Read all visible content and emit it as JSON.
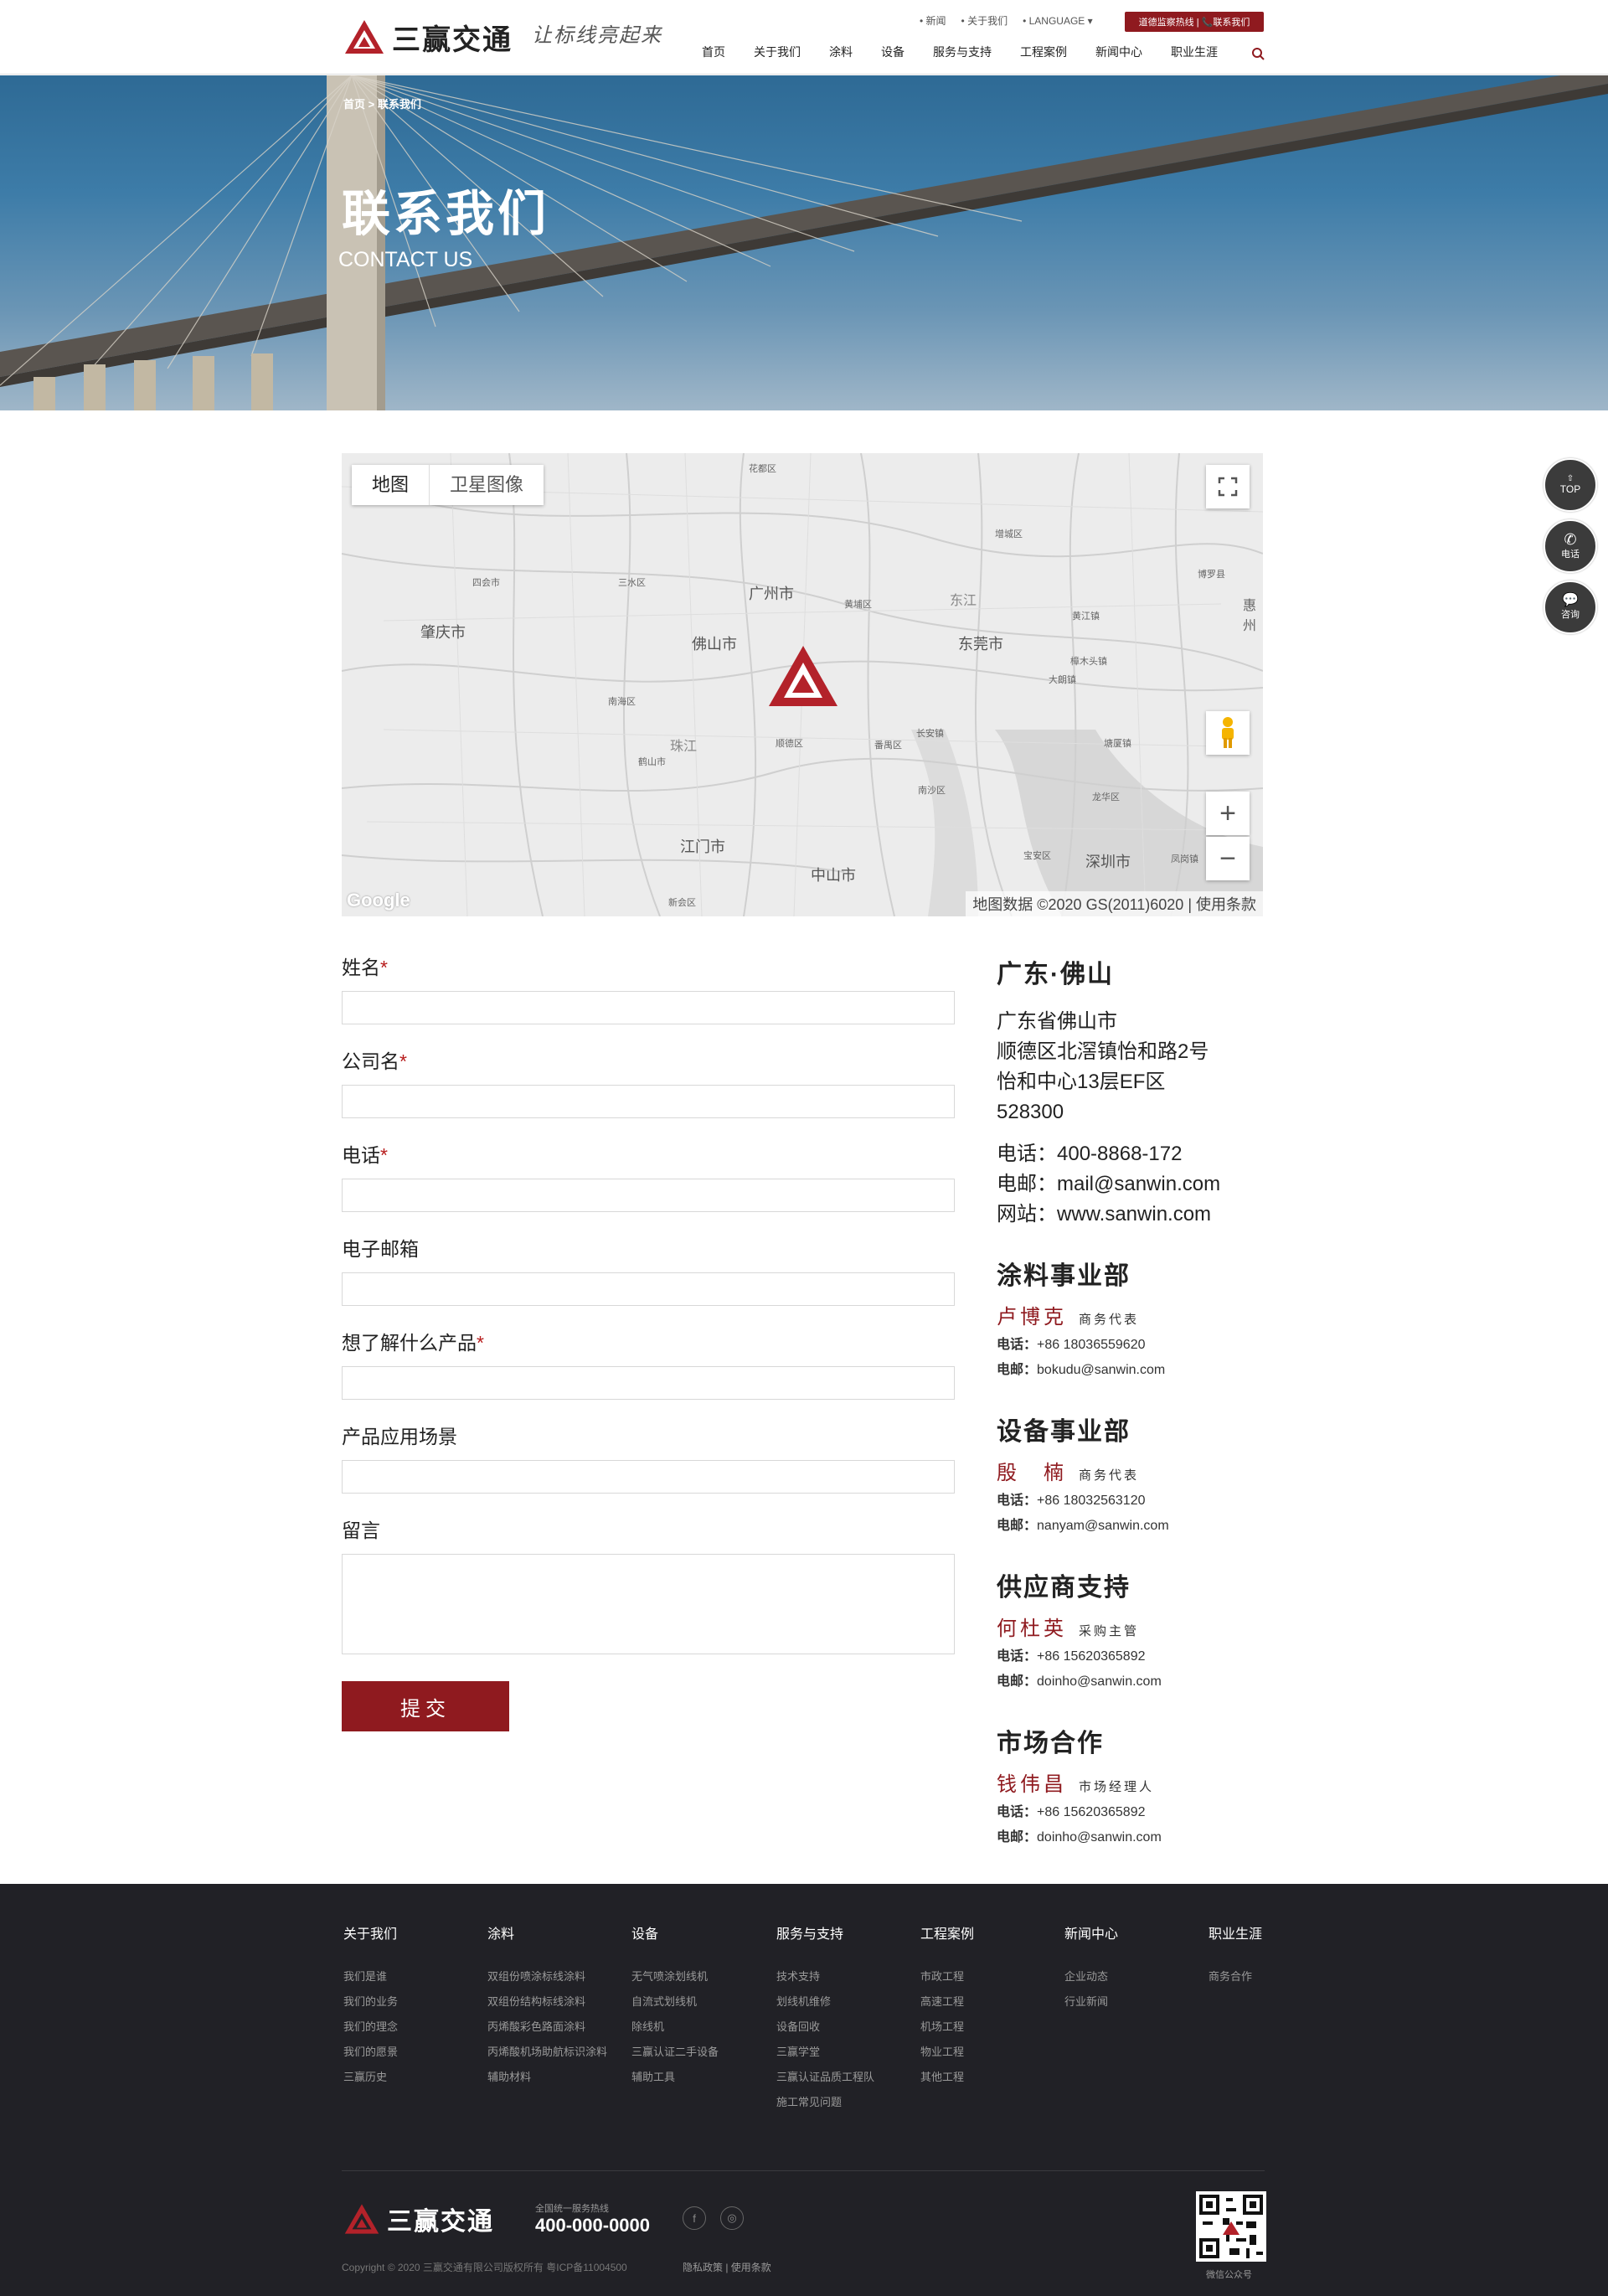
{
  "header": {
    "logo_text": "三赢交通",
    "slogan": "让标线亮起来",
    "top_links": [
      "• 新闻",
      "• 关于我们",
      "• LANGUAGE ▾"
    ],
    "hotline_btn": "道德监察热线 | 📞联系我们",
    "nav": [
      "首页",
      "关于我们",
      "涂料",
      "设备",
      "服务与支持",
      "工程案例",
      "新闻中心",
      "职业生涯"
    ]
  },
  "hero": {
    "breadcrumb": "首页 > 联系我们",
    "title": "联系我们",
    "subtitle": "CONTACT US"
  },
  "map": {
    "tab_map": "地图",
    "tab_satellite": "卫星图像",
    "footer": "地图数据 ©2020 GS(2011)6020  |  使用条款",
    "google": "Google",
    "labels": [
      "广州市",
      "佛山市",
      "东莞市",
      "肇庆市",
      "江门市",
      "中山市",
      "深圳市"
    ],
    "small_labels": [
      "花都区",
      "增城区",
      "博罗县",
      "惠州",
      "三水区",
      "四会市",
      "南海区",
      "黄埔区",
      "番禺区",
      "顺德区",
      "鹤山市",
      "新会区",
      "宝安区",
      "龙华区",
      "大朗镇",
      "樟木头镇",
      "塘厦镇",
      "凤岗镇",
      "长安镇",
      "南沙区",
      "珠江",
      "东江",
      "黄江镇"
    ],
    "zoom_in": "+",
    "zoom_out": "−"
  },
  "form": {
    "fields": [
      {
        "label": "姓名",
        "required": "*"
      },
      {
        "label": "公司名",
        "required": "*"
      },
      {
        "label": "电话",
        "required": "*"
      },
      {
        "label": "电子邮箱",
        "required": ""
      },
      {
        "label": "想了解什么产品",
        "required": "*"
      },
      {
        "label": "产品应用场景",
        "required": ""
      },
      {
        "label": "留言",
        "required": ""
      }
    ],
    "submit": "提交"
  },
  "contact": {
    "region": "广东·佛山",
    "address": [
      "广东省佛山市",
      "顺德区北滘镇怡和路2号",
      "怡和中心13层EF区",
      "528300"
    ],
    "phone": "电话：400-8868-172",
    "email": "电邮：mail@sanwin.com",
    "web": "网站：www.sanwin.com",
    "departments": [
      {
        "title": "涂料事业部",
        "name": "卢博克",
        "role": "商务代表",
        "tel_label": "电话：",
        "tel": "+86 18036559620",
        "mail_label": "电邮：",
        "mail": "bokudu@sanwin.com"
      },
      {
        "title": "设备事业部",
        "name": "殷　楠",
        "role": "商务代表",
        "tel_label": "电话：",
        "tel": "+86 18032563120",
        "mail_label": "电邮：",
        "mail": "nanyam@sanwin.com"
      },
      {
        "title": "供应商支持",
        "name": "何杜英",
        "role": "采购主管",
        "tel_label": "电话：",
        "tel": "+86 15620365892",
        "mail_label": "电邮：",
        "mail": "doinho@sanwin.com"
      },
      {
        "title": "市场合作",
        "name": "钱伟昌",
        "role": "市场经理人",
        "tel_label": "电话：",
        "tel": "+86 15620365892",
        "mail_label": "电邮：",
        "mail": "doinho@sanwin.com"
      }
    ]
  },
  "side": {
    "top": "TOP",
    "phone": "电话",
    "consult": "咨询"
  },
  "footer": {
    "columns": [
      {
        "title": "关于我们",
        "items": [
          "我们是谁",
          "我们的业务",
          "我们的理念",
          "我们的愿景",
          "三赢历史"
        ]
      },
      {
        "title": "涂料",
        "items": [
          "双组份喷涂标线涂料",
          "双组份结构标线涂料",
          "丙烯酸彩色路面涂料",
          "丙烯酸机场助航标识涂料",
          "辅助材料"
        ]
      },
      {
        "title": "设备",
        "items": [
          "无气喷涂划线机",
          "自流式划线机",
          "除线机",
          "三赢认证二手设备",
          "辅助工具"
        ]
      },
      {
        "title": "服务与支持",
        "items": [
          "技术支持",
          "划线机维修",
          "设备回收",
          "三赢学堂",
          "三赢认证品质工程队",
          "施工常见问题"
        ]
      },
      {
        "title": "工程案例",
        "items": [
          "市政工程",
          "高速工程",
          "机场工程",
          "物业工程",
          "其他工程"
        ]
      },
      {
        "title": "新闻中心",
        "items": [
          "企业动态",
          "行业新闻"
        ]
      },
      {
        "title": "职业生涯",
        "items": [
          "商务合作"
        ]
      }
    ],
    "logo_text": "三赢交通",
    "hotline_label": "全国统一服务热线",
    "hotline": "400-000-0000",
    "copyright": "Copyright © 2020 三赢交通有限公司版权所有 粤ICP备11004500",
    "privacy": "隐私政策    |    使用条款",
    "qr_label": "微信公众号"
  },
  "colors": {
    "brand": "#8f1a1f",
    "footer_bg": "#212126"
  }
}
